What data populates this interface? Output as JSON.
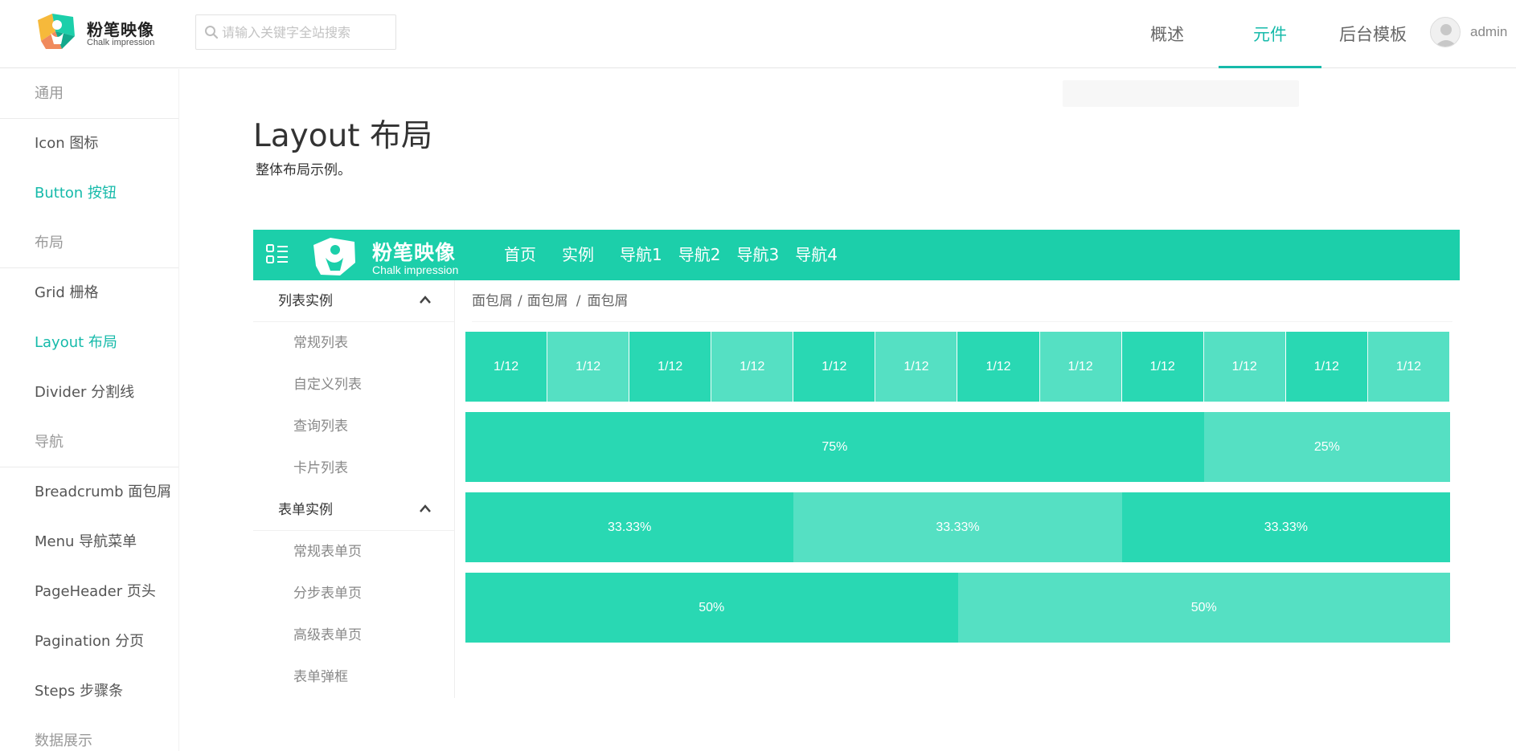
{
  "header": {
    "logo": {
      "cn": "粉笔映像",
      "en": "Chalk impression"
    },
    "search": {
      "placeholder": "请输入关键字全站搜索"
    },
    "nav": [
      {
        "label": "概述",
        "active": false
      },
      {
        "label": "元件",
        "active": true
      },
      {
        "label": "后台模板",
        "active": false
      }
    ],
    "user": {
      "name": "admin"
    }
  },
  "sidebar": {
    "items": [
      {
        "type": "group",
        "label": "通用"
      },
      {
        "type": "item",
        "label": "Icon 图标",
        "active": false
      },
      {
        "type": "item",
        "label": "Button 按钮",
        "active": true
      },
      {
        "type": "group",
        "label": "布局"
      },
      {
        "type": "item",
        "label": "Grid 栅格",
        "active": false
      },
      {
        "type": "item",
        "label": "Layout 布局",
        "active": true
      },
      {
        "type": "item",
        "label": "Divider 分割线",
        "active": false
      },
      {
        "type": "group",
        "label": "导航"
      },
      {
        "type": "item",
        "label": "Breadcrumb 面包屑",
        "active": false
      },
      {
        "type": "item",
        "label": "Menu 导航菜单",
        "active": false
      },
      {
        "type": "item",
        "label": "PageHeader 页头",
        "active": false
      },
      {
        "type": "item",
        "label": "Pagination 分页",
        "active": false
      },
      {
        "type": "item",
        "label": "Steps 步骤条",
        "active": false
      },
      {
        "type": "group",
        "label": "数据展示"
      }
    ]
  },
  "page": {
    "title": "Layout 布局",
    "description": "整体布局示例。"
  },
  "demo": {
    "logo": {
      "cn": "粉笔映像",
      "en": "Chalk impression"
    },
    "nav": [
      "首页",
      "实例",
      "导航1",
      "导航2",
      "导航3",
      "导航4"
    ],
    "side": [
      {
        "label": "列表实例",
        "children": [
          "常规列表",
          "自定义列表",
          "查询列表",
          "卡片列表"
        ]
      },
      {
        "label": "表单实例",
        "children": [
          "常规表单页",
          "分步表单页",
          "高级表单页",
          "表单弹框"
        ]
      }
    ],
    "breadcrumb": [
      "面包屑",
      "面包屑",
      "面包屑"
    ],
    "breadcrumb_sep": "/",
    "rows": [
      {
        "cells": [
          {
            "label": "1/12",
            "span": 1
          },
          {
            "label": "1/12",
            "span": 1
          },
          {
            "label": "1/12",
            "span": 1
          },
          {
            "label": "1/12",
            "span": 1
          },
          {
            "label": "1/12",
            "span": 1
          },
          {
            "label": "1/12",
            "span": 1
          },
          {
            "label": "1/12",
            "span": 1
          },
          {
            "label": "1/12",
            "span": 1
          },
          {
            "label": "1/12",
            "span": 1
          },
          {
            "label": "1/12",
            "span": 1
          },
          {
            "label": "1/12",
            "span": 1
          },
          {
            "label": "1/12",
            "span": 1
          }
        ]
      },
      {
        "cells": [
          {
            "label": "75%",
            "span": 9
          },
          {
            "label": "25%",
            "span": 3
          }
        ]
      },
      {
        "cells": [
          {
            "label": "33.33%",
            "span": 4
          },
          {
            "label": "33.33%",
            "span": 4
          },
          {
            "label": "33.33%",
            "span": 4
          }
        ]
      },
      {
        "cells": [
          {
            "label": "50%",
            "span": 6
          },
          {
            "label": "50%",
            "span": 6
          }
        ]
      }
    ]
  },
  "colors": {
    "accent": "#16baaa",
    "demo_header": "#1ccfaa",
    "cell_dark": "#29d8b3",
    "cell_light": "#55e0c3"
  }
}
